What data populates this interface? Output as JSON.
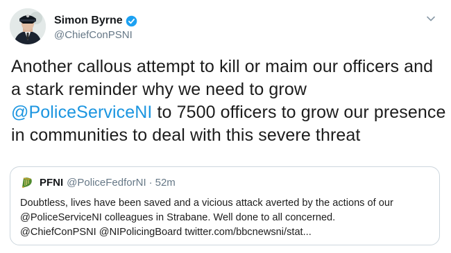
{
  "author": {
    "display_name": "Simon Byrne",
    "handle": "@ChiefConPSNI",
    "verified": true
  },
  "tweet": {
    "line1": "Another callous attempt to kill or maim our officers and",
    "line2": "a stark reminder why we need to grow",
    "line3_mention": "@PoliceServiceNI",
    "line3_rest": " to 7500 officers to grow our presence",
    "line4": "in communities to deal with this severe threat"
  },
  "quoted_tweet": {
    "display_name": "PFNI",
    "handle": "@PoliceFedforNI",
    "separator": "·",
    "time": "52m",
    "line1": "Doubtless, lives have been saved and a vicious attack averted by the actions of our",
    "line2": "@PoliceServiceNI colleagues in Strabane. Well done to all concerned.",
    "line3": "@ChiefConPSNI @NIPolicingBoard twitter.com/bbcnewsni/stat..."
  },
  "icons": {
    "verified": "verified-badge-icon",
    "menu": "chevron-down-icon",
    "quote_avatar": "harp-logo-icon"
  },
  "colors": {
    "link": "#1b95e0",
    "secondary_text": "#657786",
    "border": "#ccd6dd"
  }
}
